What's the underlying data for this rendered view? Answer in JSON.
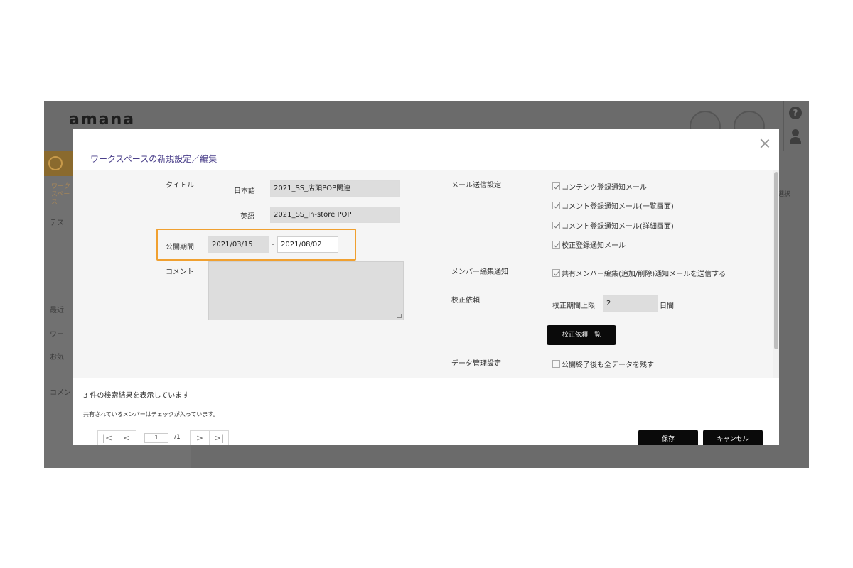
{
  "app": {
    "logo": "amana",
    "side_tab": "ワークスペース",
    "side_items": [
      "テス",
      "最近",
      "ワー",
      "お気",
      "コメント"
    ],
    "right_label": "選択"
  },
  "modal": {
    "title": "ワークスペースの新規設定／編集",
    "title_section": {
      "label": "タイトル",
      "japanese_label": "日本語",
      "japanese_value": "2021_SS_店頭POP関連",
      "english_label": "英語",
      "english_value": "2021_SS_In-store POP"
    },
    "period": {
      "label": "公開期間",
      "start": "2021/03/15",
      "separator": "-",
      "end": "2021/08/02"
    },
    "comment_label": "コメント",
    "mail": {
      "label": "メール送信設定",
      "options": [
        {
          "text": "コンテンツ登録通知メール",
          "checked": true
        },
        {
          "text": "コメント登録通知メール(一覧画面)",
          "checked": true
        },
        {
          "text": "コメント登録通知メール(詳細画面)",
          "checked": true
        },
        {
          "text": "校正登録通知メール",
          "checked": true
        }
      ]
    },
    "member": {
      "label": "メンバー編集通知",
      "option": "共有メンバー編集(追加/削除)通知メールを送信する",
      "checked": true
    },
    "proof": {
      "label": "校正依頼",
      "limit_label": "校正期間上限",
      "limit_value": "2",
      "unit": "日間",
      "list_button": "校正依頼一覧"
    },
    "data_mgmt": {
      "label": "データ管理設定",
      "option": "公開終了後も全データを残す",
      "checked": false
    },
    "results_text": "3 件の検索結果を表示しています",
    "shared_note": "共有されているメンバーはチェックが入っています。",
    "pager": {
      "current": "1",
      "total": "/1",
      "first": "|<",
      "prev": "<",
      "next": ">",
      "last": ">|"
    },
    "save_button": "保存",
    "cancel_button": "キャンセル"
  },
  "colors": {
    "highlight": "#f0a030",
    "title": "#4a3f8a",
    "overlay": "#6b6b6b"
  }
}
